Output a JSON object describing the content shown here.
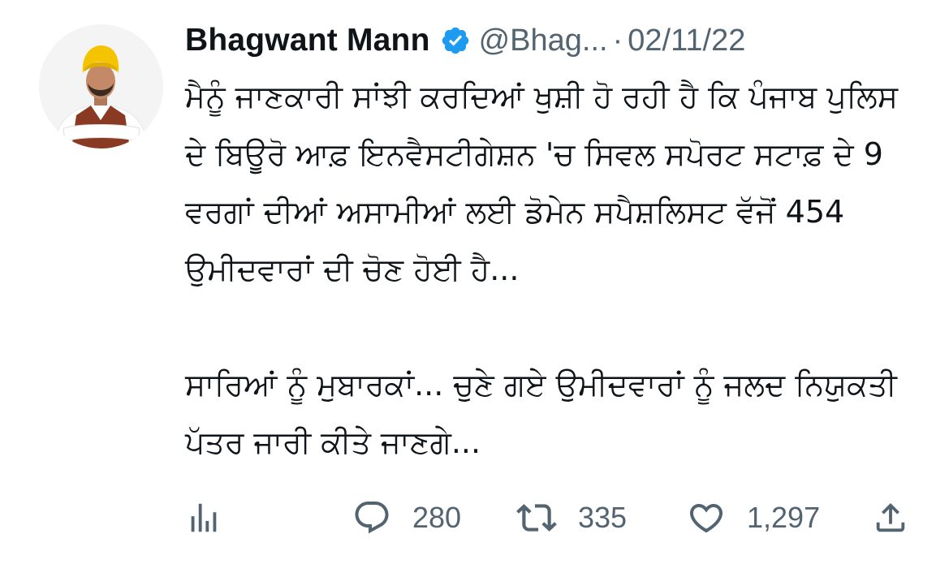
{
  "author": {
    "name": "Bhagwant Mann",
    "handle": "@Bhag...",
    "separator": "·",
    "date": "02/11/22",
    "verified_color": "#1d9bf0"
  },
  "tweet": {
    "lines": [
      "ਮੈਨੂੰ ਜਾਣਕਾਰੀ ਸਾਂਝੀ ਕਰਦਿਆਂ ਖੁਸ਼ੀ ਹੋ ਰਹੀ ਹੈ ਕਿ ਪੰਜਾਬ ਪੁਲਿਸ",
      "ਦੇ ਬਿਊਰੋ ਆਫ਼ ਇਨਵੈਸਟੀਗੇਸ਼ਨ 'ਚ ਸਿਵਲ ਸਪੋਰਟ ਸਟਾਫ਼ ਦੇ 9",
      "ਵਰਗਾਂ ਦੀਆਂ ਅਸਾਮੀਆਂ ਲਈ ਡੋਮੇਨ ਸਪੈਸ਼ਲਿਸਟ ਵੱਜੋਂ 454",
      "ਉਮੀਦਵਾਰਾਂ ਦੀ ਚੋਣ ਹੋਈ ਹੈ...",
      "ਸਾਰਿਆਂ ਨੂੰ ਮੁਬਾਰਕਾਂ... ਚੁਣੇ ਗਏ ਉਮੀਦਵਾਰਾਂ ਨੂੰ ਜਲਦ ਨਿਯੁਕਤੀ",
      "ਪੱਤਰ ਜਾਰੀ ਕੀਤੇ ਜਾਣਗੇ..."
    ]
  },
  "actions": {
    "analytics_icon": "analytics-icon",
    "reply_icon": "reply-icon",
    "reply_count": "280",
    "retweet_icon": "retweet-icon",
    "retweet_count": "335",
    "like_icon": "like-icon",
    "like_count": "1,297",
    "share_icon": "share-icon"
  },
  "colors": {
    "text": "#0f1419",
    "secondary": "#536471",
    "verified": "#1d9bf0"
  }
}
